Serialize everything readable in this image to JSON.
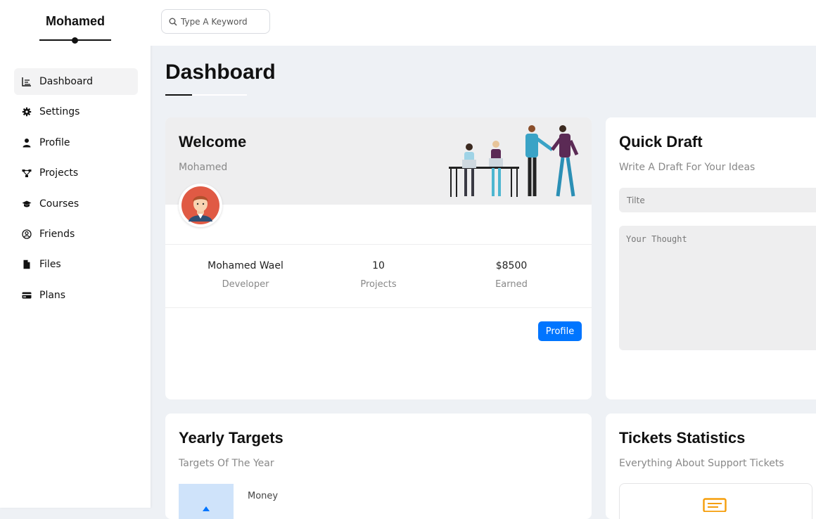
{
  "sidebar": {
    "brand": "Mohamed",
    "items": [
      {
        "label": "Dashboard",
        "icon": "chart-icon",
        "active": true
      },
      {
        "label": "Settings",
        "icon": "gear-icon"
      },
      {
        "label": "Profile",
        "icon": "user-icon"
      },
      {
        "label": "Projects",
        "icon": "diagram-icon"
      },
      {
        "label": "Courses",
        "icon": "graduation-cap-icon"
      },
      {
        "label": "Friends",
        "icon": "user-circle-icon"
      },
      {
        "label": "Files",
        "icon": "file-icon"
      },
      {
        "label": "Plans",
        "icon": "credit-card-icon"
      }
    ]
  },
  "header": {
    "search_placeholder": "Type A Keyword"
  },
  "main": {
    "title": "Dashboard",
    "welcome": {
      "title": "Welcome",
      "subtitle": "Mohamed",
      "stats": [
        {
          "value": "Mohamed Wael",
          "label": "Developer"
        },
        {
          "value": "10",
          "label": "Projects"
        },
        {
          "value": "$8500",
          "label": "Earned"
        }
      ],
      "button_label": "Profile"
    },
    "quick_draft": {
      "title": "Quick Draft",
      "subtitle": "Write A Draft For Your Ideas",
      "title_placeholder": "Tilte",
      "thought_placeholder": "Your Thought"
    },
    "yearly_targets": {
      "title": "Yearly Targets",
      "subtitle": "Targets Of The Year",
      "first_target_label": "Money"
    },
    "tickets": {
      "title": "Tickets Statistics",
      "subtitle": "Everything About Support Tickets"
    }
  },
  "colors": {
    "accent": "#0075ff",
    "page_background": "#eef1f5",
    "card_header": "#eeeeef",
    "target_fill": "#cfe3fa",
    "ticket_icon": "#f59e0b"
  }
}
